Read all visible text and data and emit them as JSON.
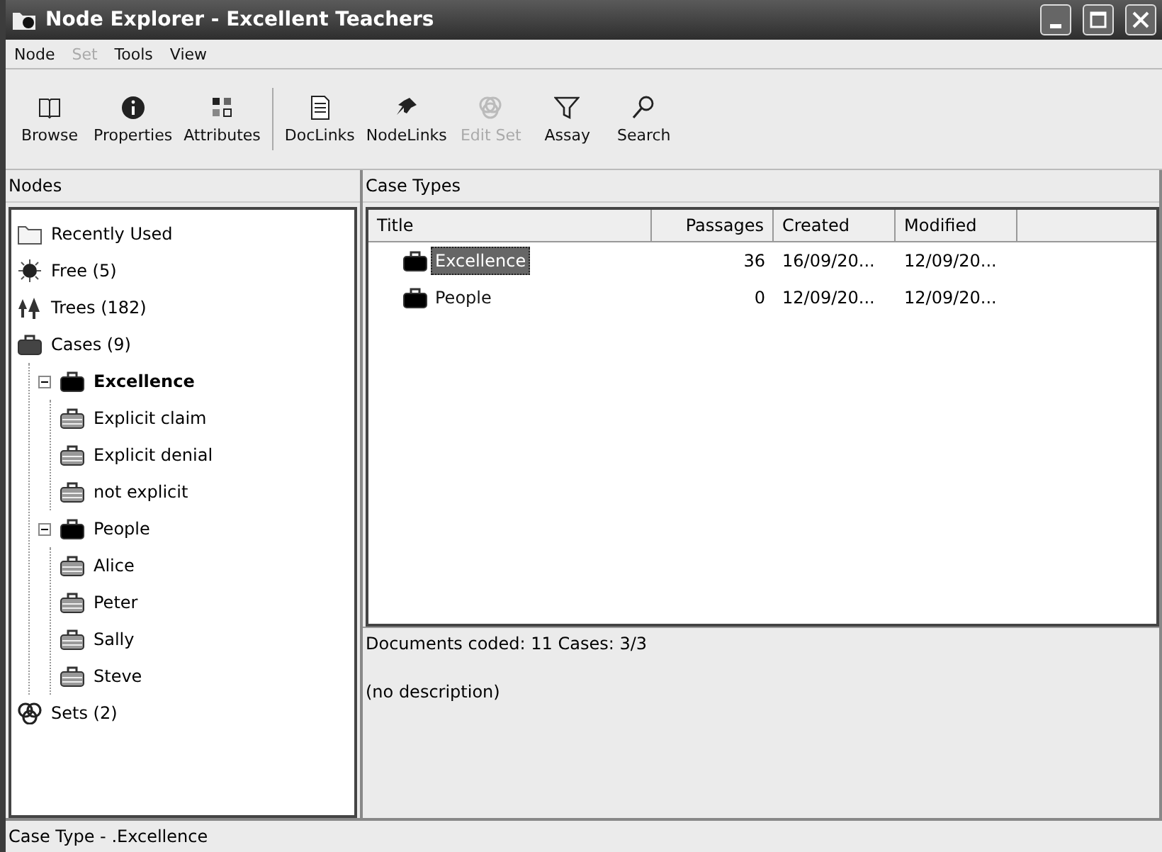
{
  "window": {
    "title": "Node Explorer - Excellent Teachers"
  },
  "menu": [
    {
      "label": "Node",
      "disabled": false
    },
    {
      "label": "Set",
      "disabled": true
    },
    {
      "label": "Tools",
      "disabled": false
    },
    {
      "label": "View",
      "disabled": false
    }
  ],
  "toolbar": [
    [
      {
        "label": "Browse",
        "kind": "book",
        "disabled": false
      },
      {
        "label": "Properties",
        "kind": "info",
        "disabled": false
      },
      {
        "label": "Attributes",
        "kind": "attributes",
        "disabled": false
      }
    ],
    [
      {
        "label": "DocLinks",
        "kind": "document",
        "disabled": false
      },
      {
        "label": "NodeLinks",
        "kind": "pin",
        "disabled": false
      },
      {
        "label": "Edit Set",
        "kind": "sets",
        "disabled": true
      },
      {
        "label": "Assay",
        "kind": "filter",
        "disabled": false
      },
      {
        "label": "Search",
        "kind": "search",
        "disabled": false
      }
    ]
  ],
  "nodes_pane": {
    "title": "Nodes",
    "tree": [
      {
        "label": "Recently Used",
        "kind": "folder",
        "selected": false
      },
      {
        "label": "Free (5)",
        "kind": "free",
        "selected": false
      },
      {
        "label": "Trees (182)",
        "kind": "trees",
        "selected": false
      },
      {
        "label": "Cases (9)",
        "kind": "cases",
        "selected": false,
        "children": [
          {
            "label": "Excellence",
            "kind": "case",
            "selected": true,
            "expanded": true,
            "children": [
              {
                "label": "Explicit claim",
                "kind": "subcase",
                "selected": false
              },
              {
                "label": "Explicit denial",
                "kind": "subcase",
                "selected": false
              },
              {
                "label": "not explicit",
                "kind": "subcase",
                "selected": false
              }
            ]
          },
          {
            "label": "People",
            "kind": "case",
            "selected": false,
            "expanded": true,
            "children": [
              {
                "label": "Alice",
                "kind": "subcase",
                "selected": false
              },
              {
                "label": "Peter",
                "kind": "subcase",
                "selected": false
              },
              {
                "label": "Sally",
                "kind": "subcase",
                "selected": false
              },
              {
                "label": "Steve",
                "kind": "subcase",
                "selected": false
              }
            ]
          }
        ]
      },
      {
        "label": "Sets (2)",
        "kind": "sets",
        "selected": false
      }
    ]
  },
  "case_types_pane": {
    "title": "Case Types",
    "table": {
      "columns": [
        "Title",
        "Passages",
        "Created",
        "Modified"
      ],
      "rows": [
        {
          "title": "Excellence",
          "passages": "36",
          "created": "16/09/20...",
          "modified": "12/09/20...",
          "selected": true
        },
        {
          "title": "People",
          "passages": "0",
          "created": "12/09/20...",
          "modified": "12/09/20...",
          "selected": false
        }
      ]
    },
    "summary": "Documents coded: 11 Cases: 3/3",
    "description": "(no description)"
  },
  "status_bar": "Case Type - .Excellence"
}
